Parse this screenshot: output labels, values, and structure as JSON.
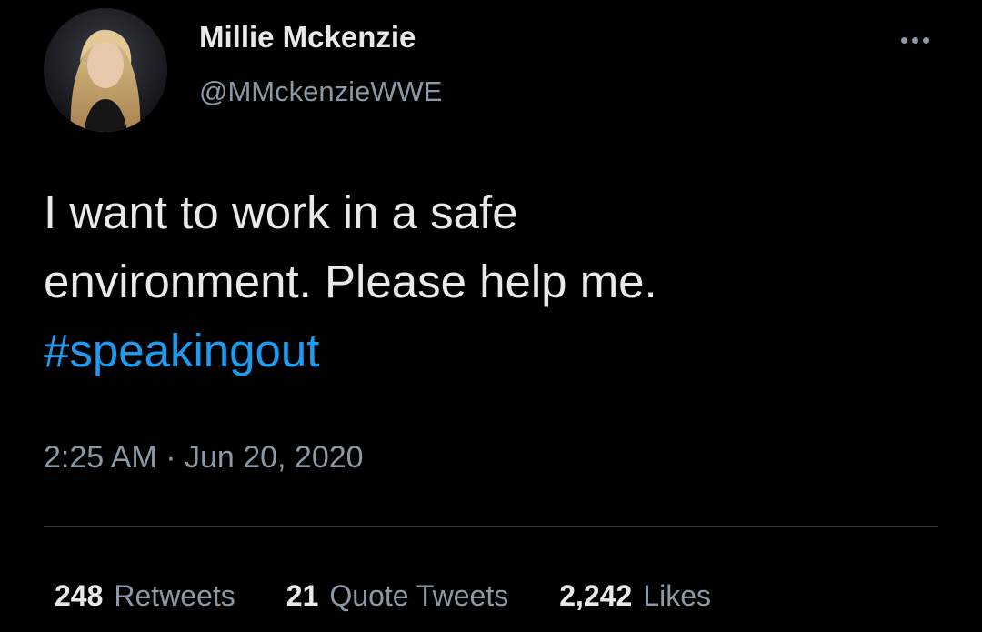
{
  "user": {
    "display_name": "Millie Mckenzie",
    "handle": "@MMckenzieWWE"
  },
  "tweet": {
    "lines": [
      "I want to work in a safe",
      "environment. Please help me."
    ],
    "hashtag": "#speakingout",
    "timestamp": "2:25 AM · Jun 20, 2020"
  },
  "stats": {
    "retweets_count": "248",
    "retweets_label": "Retweets",
    "quote_count": "21",
    "quote_label": "Quote Tweets",
    "likes_count": "2,242",
    "likes_label": "Likes"
  },
  "icons": {
    "more": "more-options-icon"
  },
  "colors": {
    "background": "#000000",
    "primary_text": "#e7e9ea",
    "secondary_text": "#8b98a5",
    "link": "#1d9bf0",
    "divider": "#2f3336"
  }
}
